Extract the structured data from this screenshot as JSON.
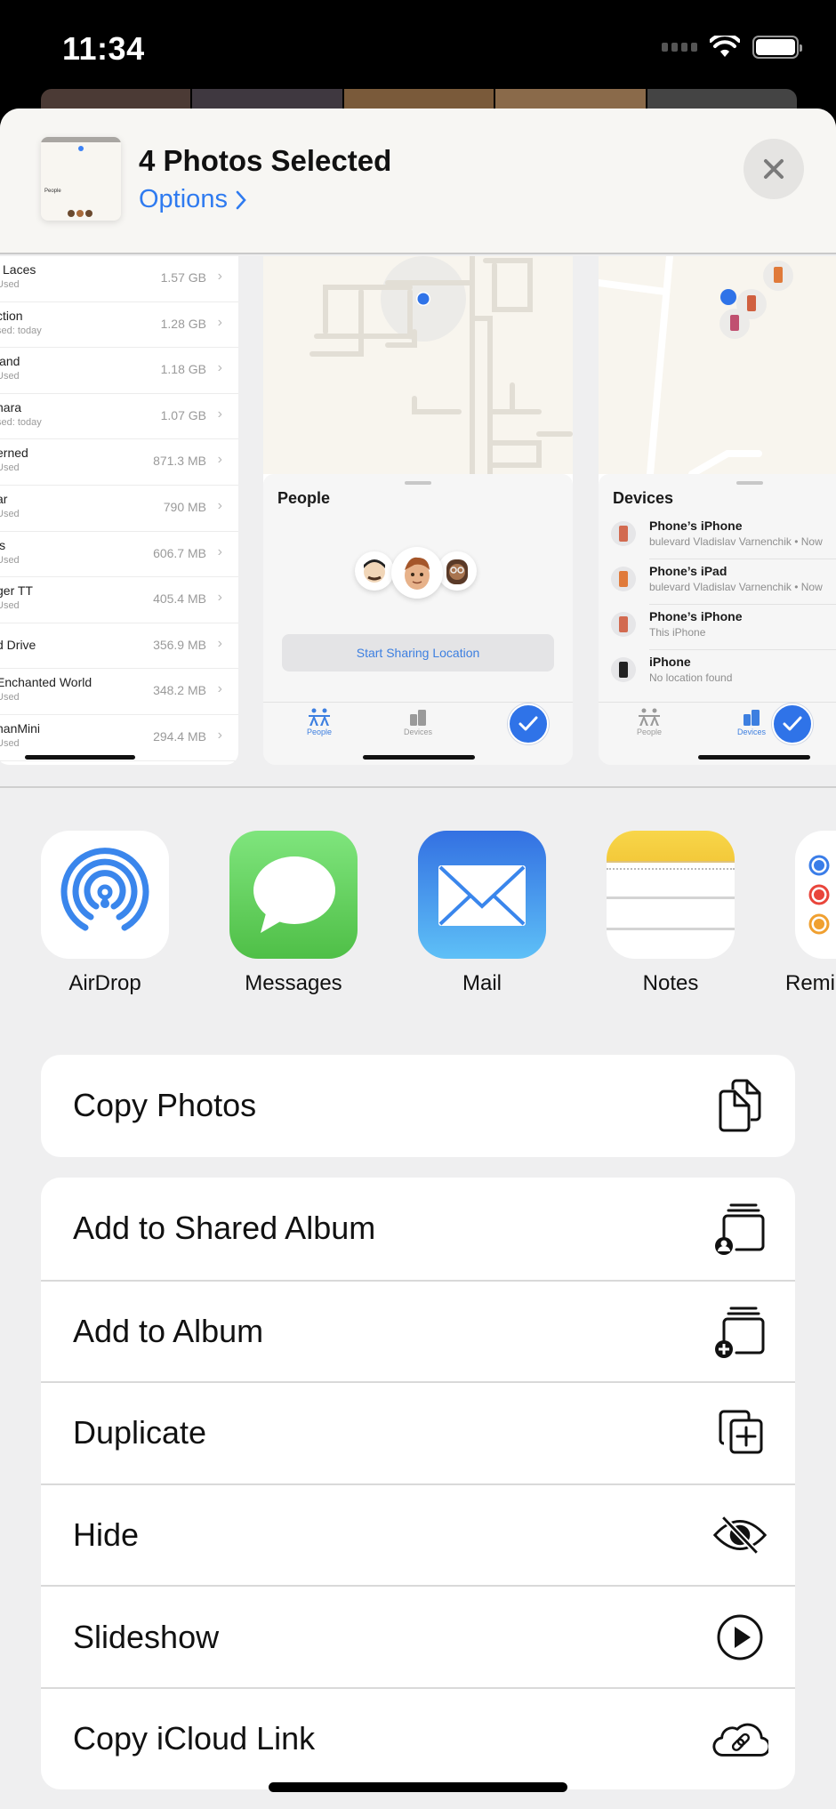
{
  "status_bar": {
    "time": "11:34",
    "icons": [
      "cellular-signal-icon",
      "wifi-icon",
      "battery-icon"
    ]
  },
  "share_sheet": {
    "title": "4 Photos Selected",
    "options_label": "Options",
    "options_icon": "chevron-right-icon",
    "close_icon": "close-icon",
    "thumbnail_label": "People"
  },
  "previews": {
    "storage_list": [
      {
        "name": "l Laces",
        "sub": "Used",
        "size": "1.57 GB"
      },
      {
        "name": "ction",
        "sub": "sed: today",
        "size": "1.28 GB"
      },
      {
        "name": "land",
        "sub": "Used",
        "size": "1.18 GB"
      },
      {
        "name": "nara",
        "sub": "sed: today",
        "size": "1.07 GB"
      },
      {
        "name": "erned",
        "sub": "Used",
        "size": "871.3 MB"
      },
      {
        "name": "ar",
        "sub": "Used",
        "size": "790 MB"
      },
      {
        "name": "ls",
        "sub": "Used",
        "size": "606.7 MB"
      },
      {
        "name": "ger TT",
        "sub": "Used",
        "size": "405.4 MB"
      },
      {
        "name": "d Drive",
        "sub": "",
        "size": "356.9 MB"
      },
      {
        "name": "Enchanted World",
        "sub": "Used",
        "size": "348.2 MB"
      },
      {
        "name": "nanMini",
        "sub": "Used",
        "size": "294.4 MB"
      }
    ],
    "people_panel": {
      "title": "People",
      "button": "Start Sharing Location",
      "tabs": [
        "People",
        "Devices"
      ],
      "active_tab": "People"
    },
    "devices_panel": {
      "title": "Devices",
      "devices": [
        {
          "name": "Phone’s iPhone",
          "sub": "bulevard Vladislav Varnenchik • Now"
        },
        {
          "name": "Phone’s iPad",
          "sub": "bulevard Vladislav Varnenchik • Now"
        },
        {
          "name": "Phone’s iPhone",
          "sub": "This iPhone"
        },
        {
          "name": "iPhone",
          "sub": "No location found"
        }
      ],
      "tabs": [
        "People",
        "Devices"
      ],
      "active_tab": "Devices"
    }
  },
  "apps": [
    {
      "label": "AirDrop",
      "icon": "airdrop-icon"
    },
    {
      "label": "Messages",
      "icon": "messages-icon"
    },
    {
      "label": "Mail",
      "icon": "mail-icon"
    },
    {
      "label": "Notes",
      "icon": "notes-icon"
    },
    {
      "label": "Reminders",
      "icon": "reminders-icon"
    }
  ],
  "actions_primary": [
    {
      "label": "Copy Photos",
      "icon": "copy-icon"
    }
  ],
  "actions_secondary": [
    {
      "label": "Add to Shared Album",
      "icon": "shared-album-icon"
    },
    {
      "label": "Add to Album",
      "icon": "add-album-icon"
    },
    {
      "label": "Duplicate",
      "icon": "duplicate-icon"
    },
    {
      "label": "Hide",
      "icon": "eye-slash-icon"
    },
    {
      "label": "Slideshow",
      "icon": "play-circle-icon"
    },
    {
      "label": "Copy iCloud Link",
      "icon": "cloud-link-icon"
    }
  ],
  "colors": {
    "accent": "#2f7bf0",
    "check": "#2f73e8",
    "sheet_bg": "#efeff0"
  }
}
